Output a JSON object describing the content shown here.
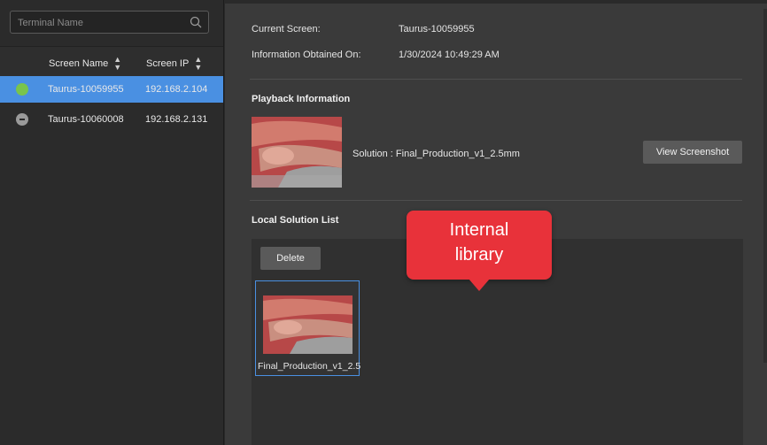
{
  "search": {
    "placeholder": "Terminal Name",
    "icon": "search-icon"
  },
  "table": {
    "columns": [
      {
        "label": "Screen Name",
        "sort_icon": "sort-icon"
      },
      {
        "label": "Screen IP",
        "sort_icon": "sort-icon"
      }
    ],
    "rows": [
      {
        "name": "Taurus-10059955",
        "ip": "192.168.2.104",
        "status": "online",
        "status_color": "#79c44d",
        "selected": true
      },
      {
        "name": "Taurus-10060008",
        "ip": "192.168.2.131",
        "status": "offline",
        "status_color": "#9a9a9a",
        "selected": false
      }
    ]
  },
  "info": {
    "current_screen_label": "Current Screen:",
    "current_screen_value": "Taurus-10059955",
    "obtained_label": "Information Obtained On:",
    "obtained_value": "1/30/2024 10:49:29 AM"
  },
  "playback": {
    "title": "Playback Information",
    "solution_text": "Solution : Final_Production_v1_2.5mm",
    "view_screenshot_label": "View Screenshot"
  },
  "local_list": {
    "title": "Local Solution List",
    "delete_label": "Delete",
    "items": [
      {
        "name": "Final_Production_v1_2.5..."
      }
    ]
  },
  "callout": {
    "text": "Internal\nlibrary"
  },
  "colors": {
    "accent": "#4a90e2",
    "callout": "#e8323a",
    "online": "#79c44d"
  }
}
